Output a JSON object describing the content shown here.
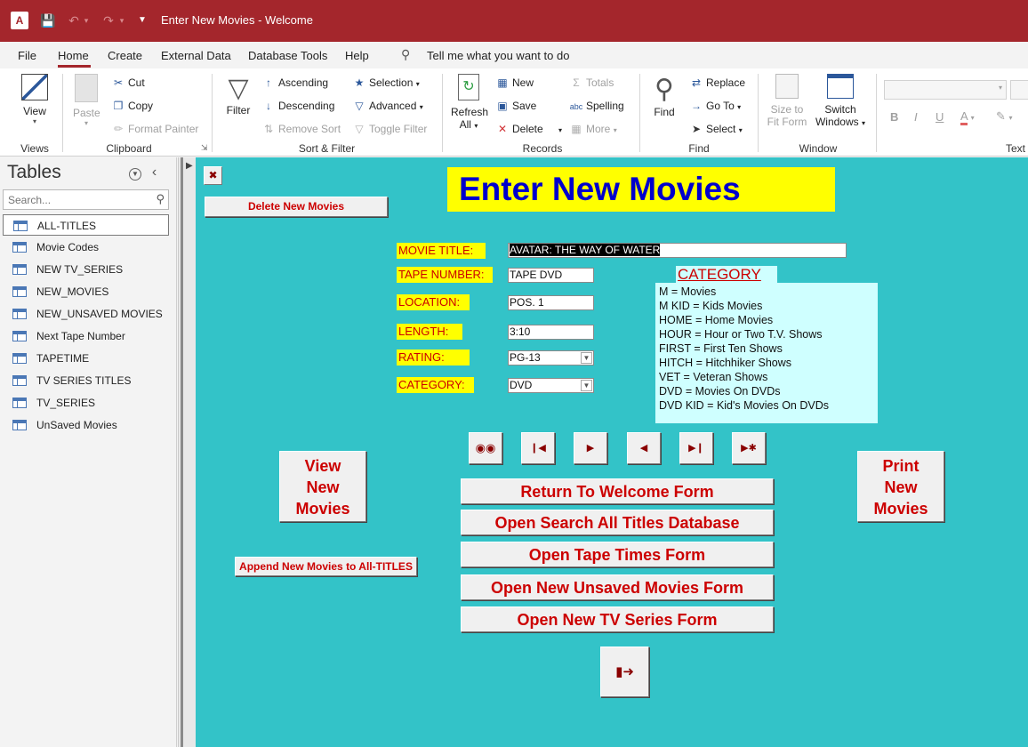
{
  "window": {
    "title": "Enter New Movies  -  Welcome",
    "app_icon": "access-icon"
  },
  "menu": {
    "items": [
      "File",
      "Home",
      "Create",
      "External Data",
      "Database Tools",
      "Help"
    ],
    "active": "Home",
    "tell_me": "Tell me what you want to do"
  },
  "ribbon": {
    "views": {
      "view": "View",
      "group": "Views"
    },
    "clipboard": {
      "paste": "Paste",
      "cut": "Cut",
      "copy": "Copy",
      "format_painter": "Format Painter",
      "group": "Clipboard"
    },
    "sort_filter": {
      "filter": "Filter",
      "ascending": "Ascending",
      "descending": "Descending",
      "remove_sort": "Remove Sort",
      "selection": "Selection",
      "advanced": "Advanced",
      "toggle_filter": "Toggle Filter",
      "group": "Sort & Filter"
    },
    "records": {
      "refresh": "Refresh",
      "refresh_all": "All",
      "new": "New",
      "save": "Save",
      "delete": "Delete",
      "totals": "Totals",
      "spelling": "Spelling",
      "more": "More",
      "group": "Records"
    },
    "find": {
      "find": "Find",
      "replace": "Replace",
      "goto": "Go To",
      "select": "Select",
      "group": "Find"
    },
    "window": {
      "size_to_fit": "Size to",
      "size_to_fit2": "Fit Form",
      "switch": "Switch",
      "switch2": "Windows",
      "group": "Window"
    },
    "text": {
      "bold": "B",
      "italic": "I",
      "underline": "U",
      "font_color": "A",
      "group": "Text"
    }
  },
  "nav": {
    "title": "Tables",
    "search_placeholder": "Search...",
    "items": [
      "ALL-TITLES",
      "Movie Codes",
      "NEW TV_SERIES",
      "NEW_MOVIES",
      "NEW_UNSAVED MOVIES",
      "Next Tape Number",
      "TAPETIME",
      "TV SERIES TITLES",
      "TV_SERIES",
      "UnSaved Movies"
    ]
  },
  "form": {
    "header": "Enter New Movies",
    "delete_button": "Delete New Movies",
    "fields": {
      "movie_title_label": "MOVIE TITLE:",
      "movie_title_value": "AVATAR: THE WAY OF WATER",
      "tape_number_label": "TAPE NUMBER:",
      "tape_number_value": "TAPE DVD",
      "location_label": "LOCATION:",
      "location_value": "POS. 1",
      "length_label": "LENGTH:",
      "length_value": "3:10",
      "rating_label": "RATING:",
      "rating_value": "PG-13",
      "category_label": "CATEGORY:",
      "category_value": "DVD"
    },
    "category_header": "CATEGORY",
    "category_lines": [
      "M = Movies",
      "M KID = Kids Movies",
      "HOME = Home Movies",
      "HOUR = Hour or Two T.V. Shows",
      "FIRST = First Ten Shows",
      "HITCH = Hitchhiker Shows",
      "VET = Veteran Shows",
      "DVD = Movies On DVDs",
      "DVD KID = Kid's Movies On DVDs"
    ],
    "view_button": [
      "View",
      "New",
      "Movies"
    ],
    "print_button": [
      "Print",
      "New",
      "Movies"
    ],
    "append_button": "Append New Movies to All-TITLES",
    "action_buttons": [
      "Return To Welcome Form",
      "Open Search All Titles Database",
      "Open Tape Times Form",
      "Open New Unsaved Movies Form",
      "Open New TV Series  Form"
    ]
  }
}
